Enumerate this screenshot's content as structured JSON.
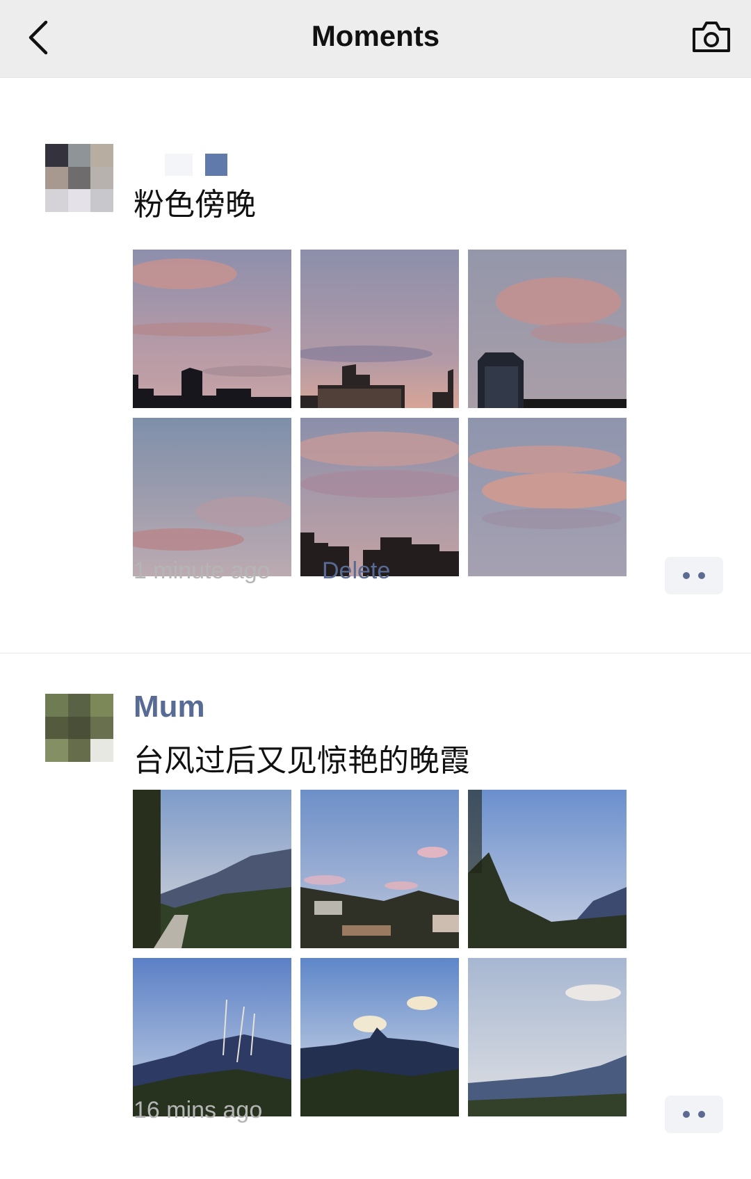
{
  "header": {
    "title": "Moments",
    "back_icon": "chevron-left-icon",
    "camera_icon": "camera-icon"
  },
  "posts": [
    {
      "nickname": "",
      "text": "粉色傍晚",
      "time": "1 minute ago",
      "delete_label": "Delete",
      "photo_count": 6
    },
    {
      "nickname": "Mum",
      "text": "台风过后又见惊艳的晚霞",
      "time": "16 mins ago",
      "photo_count": 6
    }
  ],
  "colors": {
    "link": "#576b95",
    "timestamp": "#b5b5b5",
    "header_bg": "#ededed"
  }
}
